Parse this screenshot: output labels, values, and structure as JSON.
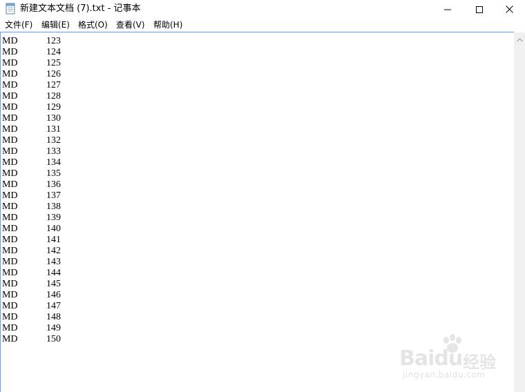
{
  "window": {
    "title": "新建文本文档 (7).txt - 记事本"
  },
  "menu": {
    "file": "文件(F)",
    "edit": "编辑(E)",
    "format": "格式(O)",
    "view": "查看(V)",
    "help": "帮助(H)"
  },
  "document": {
    "lines": [
      {
        "a": "MD",
        "b": "123"
      },
      {
        "a": "MD",
        "b": "124"
      },
      {
        "a": "MD",
        "b": "125"
      },
      {
        "a": "MD",
        "b": "126"
      },
      {
        "a": "MD",
        "b": "127"
      },
      {
        "a": "MD",
        "b": "128"
      },
      {
        "a": "MD",
        "b": "129"
      },
      {
        "a": "MD",
        "b": "130"
      },
      {
        "a": "MD",
        "b": "131"
      },
      {
        "a": "MD",
        "b": "132"
      },
      {
        "a": "MD",
        "b": "133"
      },
      {
        "a": "MD",
        "b": "134"
      },
      {
        "a": "MD",
        "b": "135"
      },
      {
        "a": "MD",
        "b": "136"
      },
      {
        "a": "MD",
        "b": "137"
      },
      {
        "a": "MD",
        "b": "138"
      },
      {
        "a": "MD",
        "b": "139"
      },
      {
        "a": "MD",
        "b": "140"
      },
      {
        "a": "MD",
        "b": "141"
      },
      {
        "a": "MD",
        "b": "142"
      },
      {
        "a": "MD",
        "b": "143"
      },
      {
        "a": "MD",
        "b": "144"
      },
      {
        "a": "MD",
        "b": "145"
      },
      {
        "a": "MD",
        "b": "146"
      },
      {
        "a": "MD",
        "b": "147"
      },
      {
        "a": "MD",
        "b": "148"
      },
      {
        "a": "MD",
        "b": "149"
      },
      {
        "a": "MD",
        "b": "150"
      }
    ]
  },
  "watermark": {
    "brand": "Bai",
    "brand_suffix": "du",
    "brand_cn": "经验",
    "url": "jingyan.baidu.com"
  },
  "icons": {
    "app": "notepad-icon",
    "minimize": "minimize-icon",
    "maximize": "maximize-icon",
    "close": "close-icon",
    "scroll_up": "chevron-up-icon"
  },
  "colors": {
    "edit_border": "#7a9ad6",
    "scrollbar_track": "#f0f0f0",
    "watermark": "#cfcfcf"
  }
}
